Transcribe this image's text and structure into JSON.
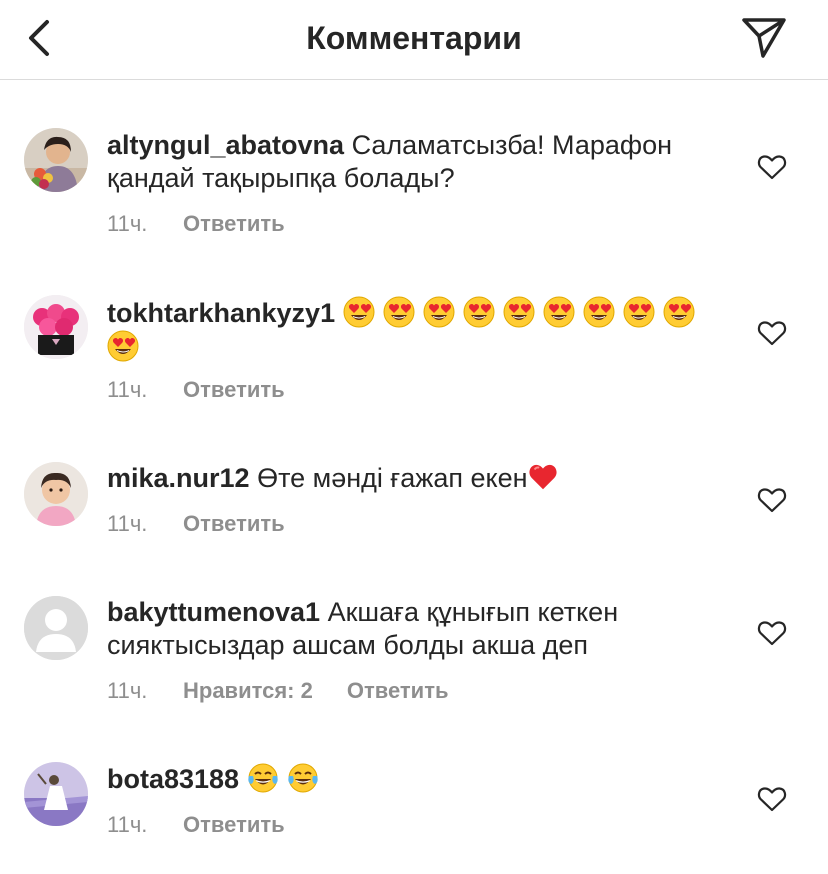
{
  "header": {
    "title": "Комментарии",
    "back_icon": "chevron-left-icon",
    "share_icon": "paper-plane-icon"
  },
  "comments": [
    {
      "username": "altyngul_abatovna",
      "text": "Саламатсызба! Марафон қандай тақырыпқа болады?",
      "time": "11ч.",
      "reply_label": "Ответить"
    },
    {
      "username": "tokhtarkhankyzy1",
      "text": "",
      "emojis": "heart-eyes-emoji x10",
      "time": "11ч.",
      "reply_label": "Ответить"
    },
    {
      "username": "mika.nur12",
      "text": "Өте мәнді ғажап екен",
      "emojis": "red-heart-emoji",
      "time": "11ч.",
      "reply_label": "Ответить"
    },
    {
      "username": "bakyttumenova1",
      "text": "Акшаға құнығып кеткен сияктысыздар ашсам болды акша деп",
      "time": "11ч.",
      "likes_label": "Нравится: 2",
      "reply_label": "Ответить"
    },
    {
      "username": "bota83188",
      "text": "",
      "emojis": "tears-of-joy-emoji x2",
      "time": "11ч.",
      "reply_label": "Ответить"
    }
  ],
  "colors": {
    "text_primary": "#262626",
    "text_secondary": "#8e8e8e",
    "divider": "#dbdbdb"
  }
}
